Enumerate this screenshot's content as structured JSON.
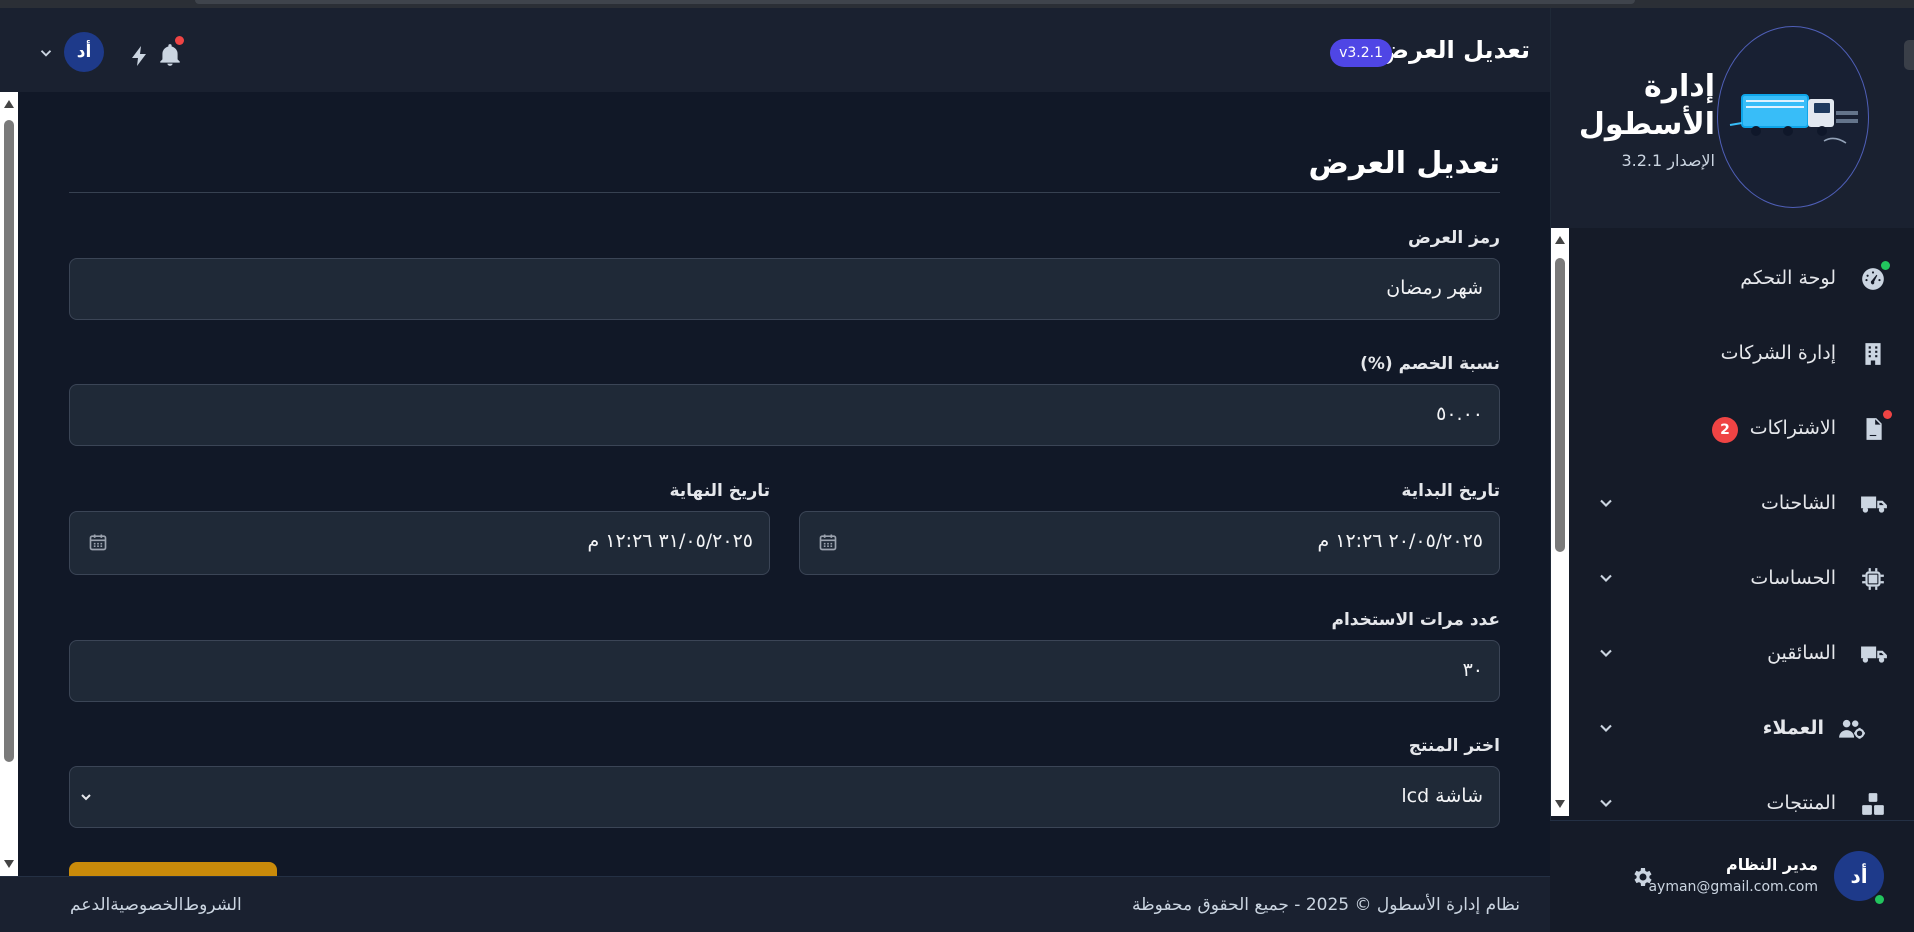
{
  "header": {
    "title": "تعديل العرض",
    "version_pill": "v3.2.1",
    "avatar_initials": "أد"
  },
  "sidebar": {
    "brand_title": "إدارة الأسطول",
    "version_label": "الإصدار 3.2.1",
    "items": [
      {
        "label": "لوحة التحكم",
        "icon": "dashboard-gauge-icon",
        "status_dot": "#22c55e"
      },
      {
        "label": "إدارة الشركات",
        "icon": "building-icon"
      },
      {
        "label": "الاشتراكات",
        "icon": "file-invoice-icon",
        "badge": "2",
        "status_dot": "#ef4444"
      },
      {
        "label": "الشاحنات",
        "icon": "truck-icon",
        "expandable": true
      },
      {
        "label": "الحساسات",
        "icon": "chip-icon",
        "expandable": true
      },
      {
        "label": "السائقين",
        "icon": "truck-icon",
        "expandable": true
      },
      {
        "label": "العملاء",
        "icon": "users-gear-icon",
        "expandable": true
      },
      {
        "label": "المنتجات",
        "icon": "boxes-icon",
        "expandable": true
      }
    ],
    "user": {
      "initials": "أد",
      "name": "مدير النظام",
      "email": "ayman@gmail.com.com"
    }
  },
  "form": {
    "title": "تعديل العرض",
    "code_label": "رمز العرض",
    "code_value": "شهر رمضان",
    "discount_label": "نسبة الخصم (%)",
    "discount_value": "٥٠.٠٠",
    "start_label": "تاريخ البداية",
    "start_value": "٢٠/٠٥/٢٠٢٥ ١٢:٢٦ م",
    "end_label": "تاريخ النهاية",
    "end_value": "٣١/٠٥/٢٠٢٥ ١٢:٢٦ م",
    "usage_label": "عدد مرات الاستخدام",
    "usage_value": "٣٠",
    "product_label": "اختر المنتج",
    "product_value": "شاشة lcd"
  },
  "footer": {
    "copyright": "نظام إدارة الأسطول © 2025 - جميع الحقوق محفوظة",
    "links": [
      "الشروط",
      "الخصوصية",
      "الدعم"
    ]
  },
  "colors": {
    "accent": "#4f46e5",
    "submit": "#c98a0a",
    "notification": "#ef4444",
    "online": "#22c55e"
  }
}
